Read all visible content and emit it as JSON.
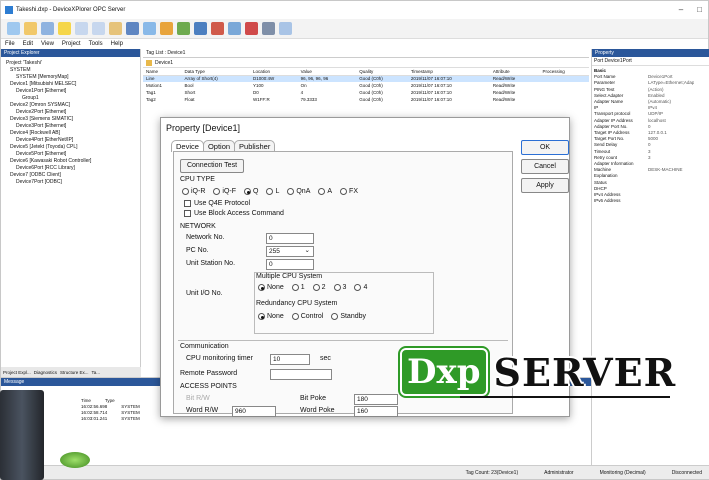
{
  "window": {
    "title": "Takeshi.dxp - DeviceXPlorer OPC Server",
    "controls": [
      "–",
      "□",
      "✕"
    ]
  },
  "menu": [
    "File",
    "Edit",
    "View",
    "Project",
    "Tools",
    "Help"
  ],
  "left_panel": {
    "header": "Project Explorer",
    "tree": [
      "Project 'Takeshi'",
      "SYSTEM",
      "SYSTEM [MemoryMap]",
      "Device1 [Mitsubishi MELSEC]",
      "Device1Port [Ethernet]",
      "Group1",
      "Device2 [Omron SYSMAC]",
      "Device2Port [Ethernet]",
      "Device3 [Siemens SIMATIC]",
      "Device3Port [Ethernet]",
      "Device4 [Rockwell AB]",
      "Device4Port [EtherNet/IP]",
      "Device5 [Jetekt (Toyoda) CPL]",
      "Device5Port [Ethernet]",
      "Device6 [Kawasaki Robot Controller]",
      "Device6Port [RCC Library]",
      "Device7 [ODBC Client]",
      "Device7Port [ODBC]"
    ],
    "bottom_tabs": [
      "Project Expl...",
      "Diagnostics",
      "Structure Ex...",
      "Ta..."
    ]
  },
  "center_panel": {
    "doc_tab": "Tag List : Device1",
    "path": "Device1",
    "filter": "Data Type",
    "columns": [
      "Name",
      "Data Type",
      "Location",
      "Value",
      "Quality",
      "Timestamp",
      "Attribute",
      "Processing"
    ],
    "rows": [
      [
        "Line",
        "Array of Short(4)",
        "D1000:4W",
        "96, 96, 96, 96",
        "Good (C0h)",
        "2019/11/07 16:07:10",
        "Read/Write",
        ""
      ],
      [
        "Motion1",
        "Bool",
        "Y100",
        "On",
        "Good (C0h)",
        "2019/11/07 16:07:10",
        "Read/Write",
        ""
      ],
      [
        "Tag1",
        "Short",
        "D0",
        "4",
        "Good (C0h)",
        "2019/11/07 16:07:10",
        "Read/Write",
        ""
      ],
      [
        "Tag2",
        "Float",
        "W1FF:R",
        "79.3333",
        "Good (C0h)",
        "2019/11/07 16:07:10",
        "Read/Write",
        ""
      ]
    ]
  },
  "right_panel": {
    "header": "Property",
    "subheader": "Port Device1Port",
    "category": "Basic",
    "props": [
      [
        "Port Name",
        "Device1Port"
      ],
      [
        "Parameter",
        "LAType=Ethernet;Adap"
      ],
      [
        "PING Test",
        "(Action)"
      ],
      [
        "Select Adapter",
        "Enabled"
      ],
      [
        "Adapter Name",
        "(Automatic)"
      ],
      [
        "IP",
        "IPv4"
      ],
      [
        "Transport protocol",
        "UDP/IP"
      ],
      [
        "Adapter IP Address",
        "localhost"
      ],
      [
        "Adapter Port No.",
        "0"
      ],
      [
        "Target IP Address",
        "127.0.0.1"
      ],
      [
        "Target Port No.",
        "5000"
      ],
      [
        "Send Delay",
        "0"
      ],
      [
        "Timeout",
        "3"
      ],
      [
        "Retry count",
        "3"
      ],
      [
        "Adapter Information",
        ""
      ],
      [
        "Machine",
        "DESK-MACHINE"
      ],
      [
        "Explanation",
        ""
      ],
      [
        "Status",
        ""
      ],
      [
        "DHCP",
        ""
      ],
      [
        "IPv4 Address",
        ""
      ],
      [
        "IPv6 Address",
        ""
      ]
    ]
  },
  "message_panel": {
    "header": "Message",
    "columns": [
      "Time",
      "Type"
    ],
    "rows": [
      [
        "16:02:56.698",
        "SYSTEM"
      ],
      [
        "16:02:58.714",
        "SYSTEM"
      ],
      [
        "16:03:01.241",
        "SYSTEM"
      ]
    ]
  },
  "status_bar": {
    "tag_count": "Tag Count: 23(Device1)",
    "user": "Administrator",
    "monitoring": "Monitoring (Decimal)",
    "connection": "Disconnected"
  },
  "dialog": {
    "title": "Property [Device1]",
    "tabs": [
      "Device",
      "Option",
      "Publisher"
    ],
    "buttons": {
      "ok": "OK",
      "cancel": "Cancel",
      "apply": "Apply"
    },
    "connection_test": "Connection Test",
    "cpu_type": {
      "label": "CPU TYPE",
      "options": [
        "iQ-R",
        "iQ-F",
        "Q",
        "L",
        "QnA",
        "A",
        "FX"
      ],
      "selected": "Q"
    },
    "checks": {
      "q4e": "Use Q4E Protocol",
      "block": "Use Block Access Command"
    },
    "network": {
      "label": "NETWORK",
      "network_no_label": "Network No.",
      "network_no": "0",
      "pc_no_label": "PC No.",
      "pc_no": "255",
      "unit_station_label": "Unit Station No.",
      "unit_station": "0"
    },
    "unit_io": {
      "label": "Unit I/O No.",
      "multiple_cpu_label": "Multiple CPU System",
      "multiple_options": [
        "None",
        "1",
        "2",
        "3",
        "4"
      ],
      "multiple_selected": "None",
      "redundancy_label": "Redundancy CPU System",
      "redundancy_options": [
        "None",
        "Control",
        "Standby"
      ],
      "redundancy_selected": "None"
    },
    "communication": {
      "label": "Communication",
      "monitor_label": "CPU monitoring timer",
      "monitor_value": "10",
      "monitor_unit": "sec",
      "remote_password_label": "Remote Password",
      "remote_password": ""
    },
    "access_points": {
      "label": "ACCESS POINTS",
      "bit_rw_label": "Bit R/W",
      "bit_poke_label": "Bit Poke",
      "bit_poke": "180",
      "word_rw_label": "Word R/W",
      "word_rw": "960",
      "word_poke_label": "Word Poke",
      "word_poke": "160"
    }
  },
  "logo": {
    "left": "Dxp",
    "right": "SERVER"
  },
  "colors": {
    "brand_green": "#2f9a27",
    "accent_blue": "#2b579a",
    "highlight": "#f5cf1e"
  }
}
